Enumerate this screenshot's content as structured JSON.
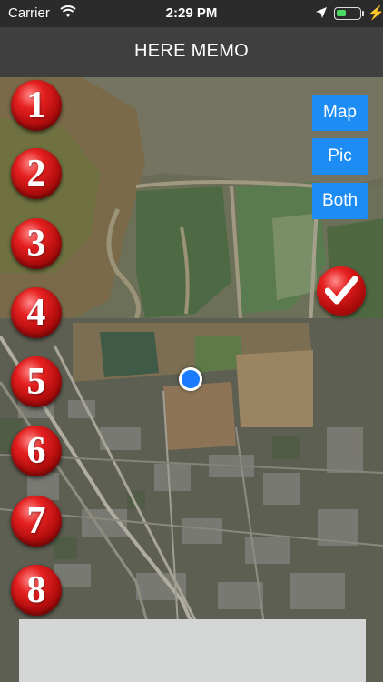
{
  "status_bar": {
    "carrier": "Carrier",
    "time": "2:29 PM",
    "battery_level_percent": 40
  },
  "nav": {
    "title": "HERE MEMO"
  },
  "number_buttons": [
    "1",
    "2",
    "3",
    "4",
    "5",
    "6",
    "7",
    "8"
  ],
  "mode_buttons": {
    "map": "Map",
    "pic": "Pic",
    "both": "Both"
  },
  "colors": {
    "accent_blue": "#1e8cf5",
    "button_red": "#d01818",
    "location_dot": "#1a7bff",
    "navbar": "#3f3f3f"
  },
  "icons": {
    "wifi": "wifi-icon",
    "location": "location-arrow-icon",
    "check": "checkmark-icon",
    "user_location": "user-location-dot"
  }
}
